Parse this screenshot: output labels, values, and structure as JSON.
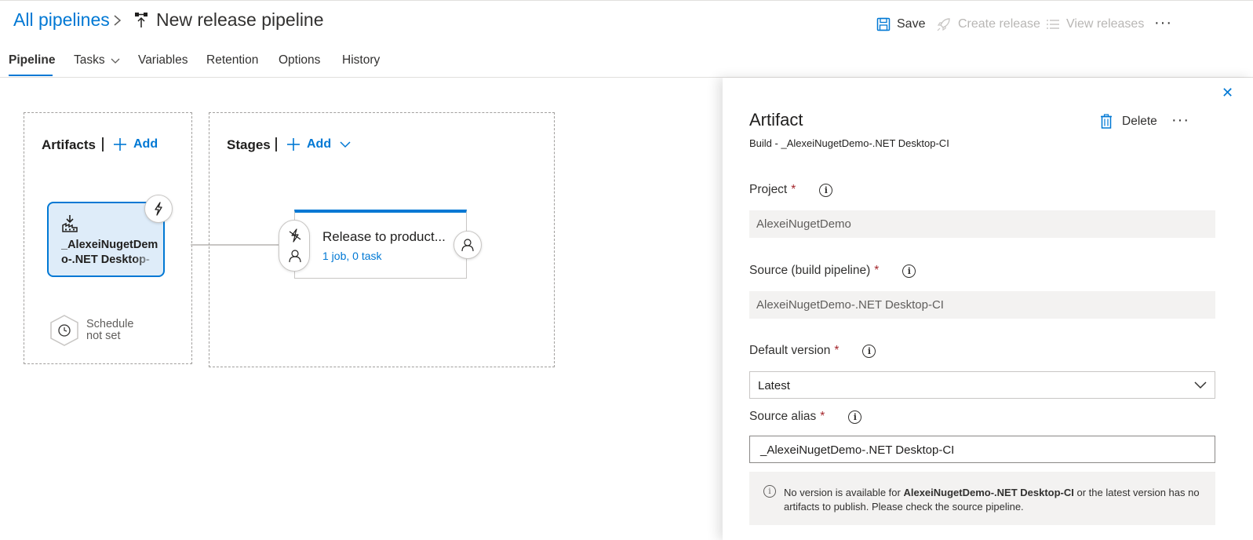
{
  "header": {
    "breadcrumb_link": "All pipelines",
    "breadcrumb_separator": ">",
    "title": "New release pipeline",
    "commands": {
      "save": "Save",
      "create_release": "Create release",
      "view_releases": "View releases",
      "more": "···"
    }
  },
  "tabs": [
    {
      "label": "Pipeline",
      "active": true
    },
    {
      "label": "Tasks"
    },
    {
      "label": "Variables"
    },
    {
      "label": "Retention"
    },
    {
      "label": "Options"
    },
    {
      "label": "History"
    }
  ],
  "canvas": {
    "artifacts": {
      "title": "Artifacts",
      "add_label": "Add",
      "card_name": "_AlexeiNugetDemo-.NET Desktop-",
      "schedule_line1": "Schedule",
      "schedule_line2": "not set"
    },
    "stages": {
      "title": "Stages",
      "add_label": "Add",
      "stage_name": "Release to product...",
      "stage_summary": "1 job, 0 task"
    }
  },
  "panel": {
    "close": "✕",
    "title": "Artifact",
    "subtitle": "Build - _AlexeiNugetDemo-.NET Desktop-CI",
    "delete_label": "Delete",
    "more": "···",
    "fields": {
      "project_label": "Project",
      "project_value": "AlexeiNugetDemo",
      "source_label": "Source (build pipeline)",
      "source_value": "AlexeiNugetDemo-.NET Desktop-CI",
      "default_version_label": "Default version",
      "default_version_value": "Latest",
      "source_alias_label": "Source alias",
      "source_alias_value": "_AlexeiNugetDemo-.NET Desktop-CI",
      "required_marker": "*"
    },
    "message": {
      "prefix": "No version is available for ",
      "bold": "AlexeiNugetDemo-.NET Desktop-CI",
      "suffix": " or the latest version has no artifacts to publish. Please check the source pipeline."
    }
  },
  "colors": {
    "accent": "#0078d4",
    "required": "#a4262c",
    "artifact_card_bg": "#deecf9",
    "disabled_text": "#b8b6b4"
  }
}
